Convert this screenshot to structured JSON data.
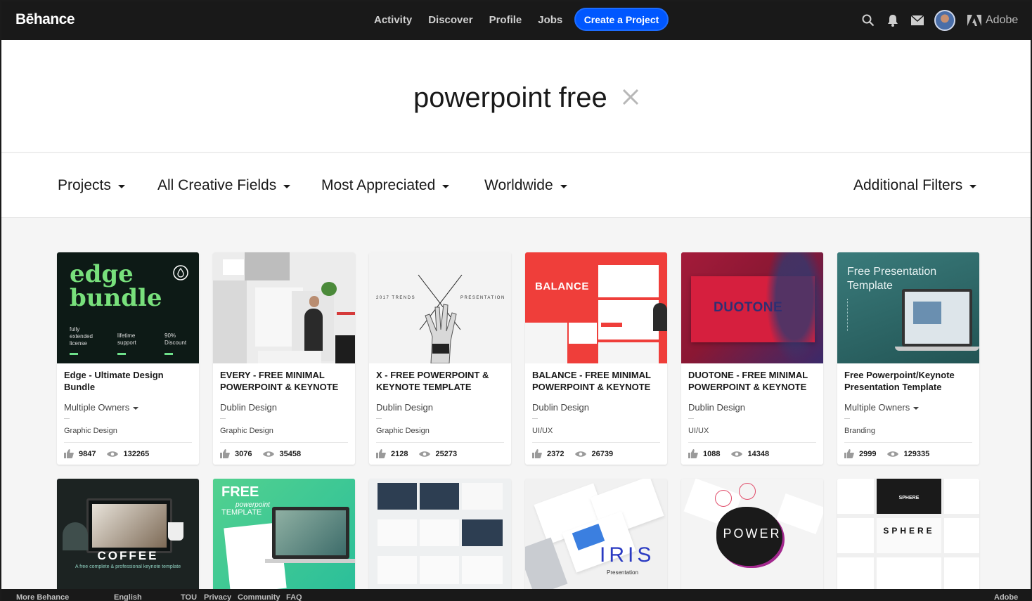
{
  "nav": {
    "logo": "Bēhance",
    "links": [
      "Activity",
      "Discover",
      "Profile",
      "Jobs"
    ],
    "create_label": "Create a Project",
    "adobe_label": "Adobe",
    "icons": [
      "search-icon",
      "bell-icon",
      "mail-icon"
    ]
  },
  "search": {
    "query": "powerpoint free"
  },
  "filters": {
    "projects": "Projects",
    "fields": "All Creative Fields",
    "sort": "Most Appreciated",
    "region": "Worldwide",
    "additional": "Additional Filters"
  },
  "cards": [
    {
      "title": "Edge - Ultimate Design Bundle",
      "owner": "Multiple Owners",
      "owner_dropdown": true,
      "field": "Graphic Design",
      "likes": "9847",
      "views": "132265",
      "thumb": {
        "headline": "edge bundle",
        "col1": "fully extended license",
        "col2": "lifetime support",
        "col3": "90% Discount"
      }
    },
    {
      "title": "EVERY - FREE MINIMAL POWERPOINT & KEYNOTE",
      "owner": "Dublin Design",
      "owner_dropdown": false,
      "field": "Graphic Design",
      "likes": "3076",
      "views": "35458"
    },
    {
      "title": "X - FREE POWERPOINT & KEYNOTE TEMPLATE",
      "owner": "Dublin Design",
      "owner_dropdown": false,
      "field": "Graphic Design",
      "likes": "2128",
      "views": "25273",
      "thumb": {
        "left": "2017 TRENDS",
        "right": "PRESENTATION"
      }
    },
    {
      "title": "BALANCE - FREE MINIMAL POWERPOINT & KEYNOTE",
      "owner": "Dublin Design",
      "owner_dropdown": false,
      "field": "UI/UX",
      "likes": "2372",
      "views": "26739",
      "thumb": {
        "headline": "BALANCE"
      }
    },
    {
      "title": "DUOTONE - FREE MINIMAL POWERPOINT & KEYNOTE",
      "owner": "Dublin Design",
      "owner_dropdown": false,
      "field": "UI/UX",
      "likes": "1088",
      "views": "14348",
      "thumb": {
        "headline": "DUOTONE"
      }
    },
    {
      "title": "Free Powerpoint/Keynote Presentation Template",
      "owner": "Multiple Owners",
      "owner_dropdown": true,
      "field": "Branding",
      "likes": "2999",
      "views": "129335",
      "thumb": {
        "line1": "Free Presentation",
        "line2": "Template"
      }
    }
  ],
  "row2": {
    "coffee": {
      "headline": "COFFEE",
      "sub": "A free complete & professional keynote template"
    },
    "freeppt": {
      "line1": "FREE",
      "line2": "powerpoint",
      "line3": "TEMPLATE"
    },
    "iris": {
      "headline": "IRIS",
      "sub": "Presentation"
    },
    "power": {
      "headline": "POWER"
    },
    "sphere": {
      "headline": "SPHERE",
      "small": "SPHERE"
    }
  },
  "footer": {
    "more": "More Behance",
    "language": "English",
    "links": [
      "TOU",
      "Privacy",
      "Community",
      "FAQ"
    ],
    "adobe": "Adobe"
  },
  "colors": {
    "nav_bg": "#191919",
    "accent": "#0057ff"
  }
}
